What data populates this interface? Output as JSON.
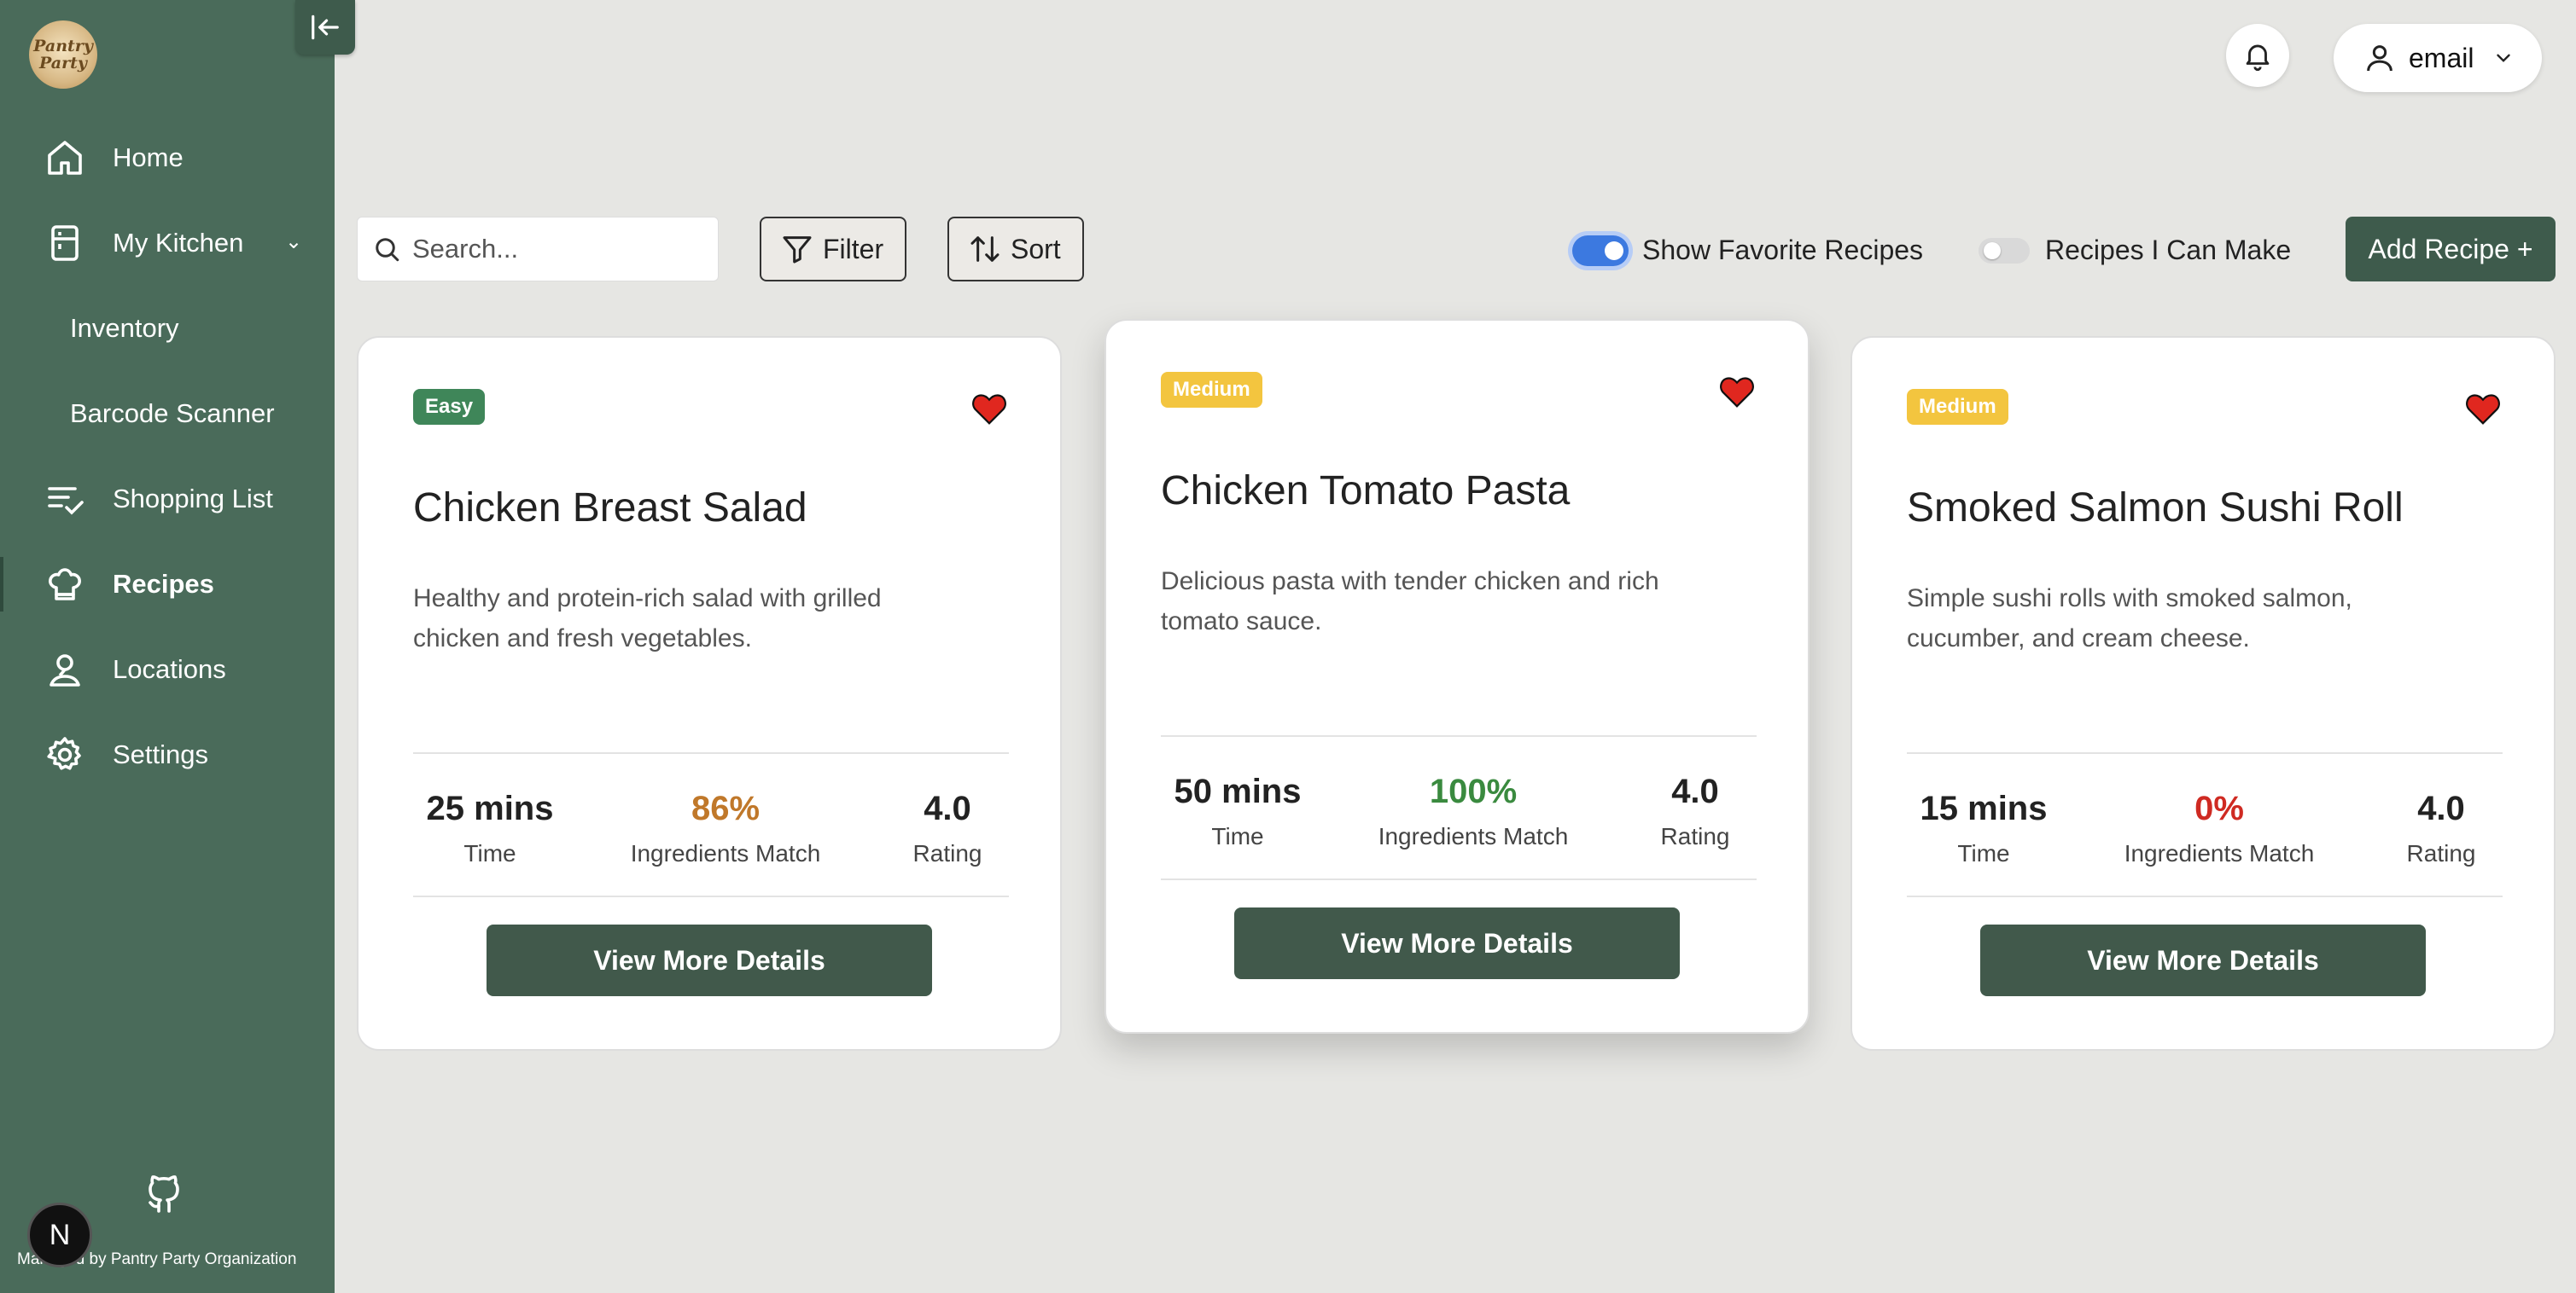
{
  "app": {
    "logo_text": "Pantry Party",
    "footer_text": "Managed by Pantry Party Organization",
    "dev_badge": "N"
  },
  "sidebar": {
    "items": [
      {
        "label": "Home",
        "icon": "home-icon"
      },
      {
        "label": "My Kitchen",
        "icon": "fridge-icon"
      },
      {
        "label": "Inventory"
      },
      {
        "label": "Barcode Scanner"
      },
      {
        "label": "Shopping List",
        "icon": "list-check-icon"
      },
      {
        "label": "Recipes",
        "icon": "chef-hat-icon",
        "active": true
      },
      {
        "label": "Locations",
        "icon": "map-pin-user-icon"
      },
      {
        "label": "Settings",
        "icon": "gear-icon"
      }
    ],
    "expand_glyph": "⌄"
  },
  "header": {
    "user_label": "email"
  },
  "toolbar": {
    "search_placeholder": "Search...",
    "filter_label": "Filter",
    "sort_label": "Sort",
    "favorites_toggle_label": "Show Favorite Recipes",
    "favorites_toggle_on": true,
    "can_make_toggle_label": "Recipes I Can Make",
    "can_make_toggle_on": false,
    "add_label": "Add Recipe +"
  },
  "colors": {
    "sidebar_bg": "#4a6b5a",
    "primary_button": "#41594b",
    "easy": "#3f8659",
    "medium": "#f3c53f",
    "match_high": "#3a8a3f",
    "match_mid": "#c0782a",
    "match_low": "#cf2a22",
    "heart": "#e0271f"
  },
  "recipes": [
    {
      "difficulty": "Easy",
      "title": "Chicken Breast Salad",
      "description": "Healthy and protein-rich salad with grilled chicken and fresh vegetables.",
      "time_value": "25 mins",
      "time_label": "Time",
      "match_value": "86%",
      "match_label": "Ingredients Match",
      "rating_value": "4.0",
      "rating_label": "Rating",
      "button_label": "View More Details",
      "favorite": true
    },
    {
      "difficulty": "Medium",
      "title": "Chicken Tomato Pasta",
      "description": "Delicious pasta with tender chicken and rich tomato sauce.",
      "time_value": "50 mins",
      "time_label": "Time",
      "match_value": "100%",
      "match_label": "Ingredients Match",
      "rating_value": "4.0",
      "rating_label": "Rating",
      "button_label": "View More Details",
      "favorite": true
    },
    {
      "difficulty": "Medium",
      "title": "Smoked Salmon Sushi Roll",
      "description": "Simple sushi rolls with smoked salmon, cucumber, and cream cheese.",
      "time_value": "15 mins",
      "time_label": "Time",
      "match_value": "0%",
      "match_label": "Ingredients Match",
      "rating_value": "4.0",
      "rating_label": "Rating",
      "button_label": "View More Details",
      "favorite": true
    }
  ]
}
